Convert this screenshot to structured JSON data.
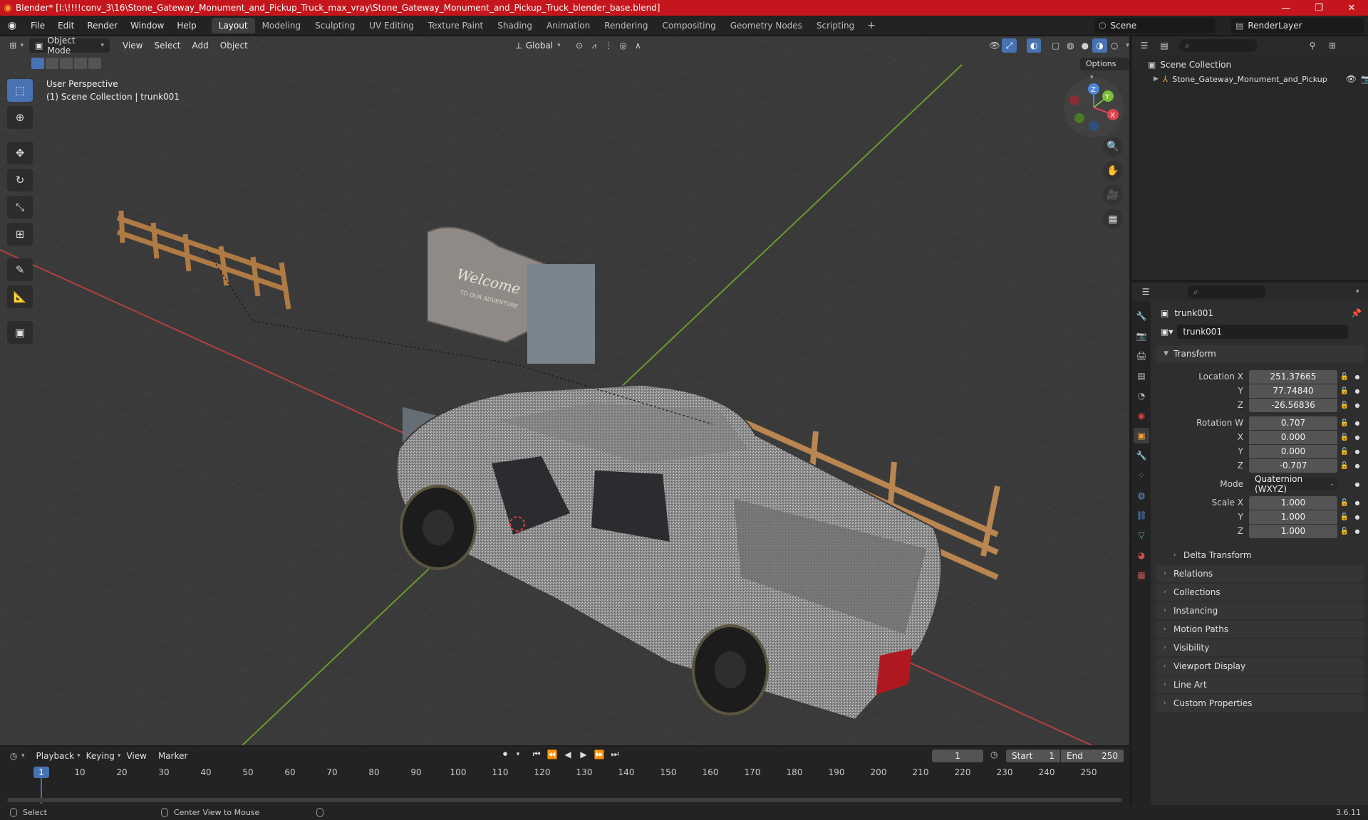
{
  "window": {
    "title": "Blender* [I:\\!!!!conv_3\\16\\Stone_Gateway_Monument_and_Pickup_Truck_max_vray\\Stone_Gateway_Monument_and_Pickup_Truck_blender_base.blend]",
    "minimize": "—",
    "maximize": "❐",
    "close": "✕"
  },
  "menu": [
    "File",
    "Edit",
    "Render",
    "Window",
    "Help"
  ],
  "workspaces": [
    "Layout",
    "Modeling",
    "Sculpting",
    "UV Editing",
    "Texture Paint",
    "Shading",
    "Animation",
    "Rendering",
    "Compositing",
    "Geometry Nodes",
    "Scripting"
  ],
  "workspace_add": "+",
  "scene": {
    "name": "Scene",
    "layer": "RenderLayer"
  },
  "viewport": {
    "mode": "Object Mode",
    "menus": [
      "View",
      "Select",
      "Add",
      "Object"
    ],
    "orientation": "Global",
    "options_label": "Options",
    "perspective": "User Perspective",
    "collection_info": "(1) Scene Collection | trunk001",
    "sign_text": "Welcome",
    "sign_subtext": "TO OUR ADVENTURE",
    "gizmo": {
      "z": "Z",
      "y": "Y",
      "x": "X"
    }
  },
  "outliner": {
    "root": "Scene Collection",
    "items": [
      {
        "name": "Stone_Gateway_Monument_and_Pickup"
      }
    ]
  },
  "properties": {
    "object_name": "trunk001",
    "data_name": "trunk001",
    "transform_label": "Transform",
    "location": {
      "label": "Location X",
      "x": "251.37665",
      "y": "77.74840",
      "z": "-26.56836"
    },
    "rotation": {
      "label": "Rotation W",
      "w": "0.707",
      "x": "0.000",
      "y": "0.000",
      "z": "-0.707"
    },
    "mode": {
      "label": "Mode",
      "value": "Quaternion (WXYZ)"
    },
    "scale": {
      "label": "Scale X",
      "x": "1.000",
      "y": "1.000",
      "z": "1.000"
    },
    "axis_labels": {
      "x": "X",
      "y": "Y",
      "z": "Z"
    },
    "delta_transform": "Delta Transform",
    "panels": [
      "Relations",
      "Collections",
      "Instancing",
      "Motion Paths",
      "Visibility",
      "Viewport Display",
      "Line Art",
      "Custom Properties"
    ]
  },
  "timeline": {
    "menus": [
      "Playback",
      "Keying",
      "View",
      "Marker"
    ],
    "current_frame": "1",
    "start_label": "Start",
    "start": "1",
    "end_label": "End",
    "end": "250",
    "ticks": [
      "10",
      "20",
      "30",
      "40",
      "50",
      "60",
      "70",
      "80",
      "90",
      "100",
      "110",
      "120",
      "130",
      "140",
      "150",
      "160",
      "170",
      "180",
      "190",
      "200",
      "210",
      "220",
      "230",
      "240",
      "250"
    ],
    "playhead": "1"
  },
  "statusbar": {
    "select": "Select",
    "center_view": "Center View to Mouse",
    "version": "3.6.11"
  }
}
